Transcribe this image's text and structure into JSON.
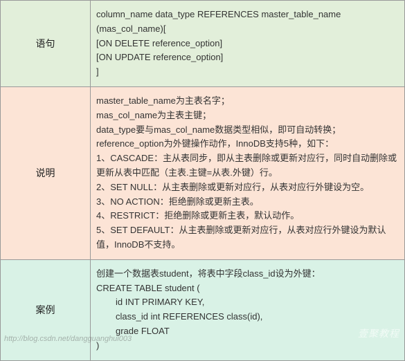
{
  "rows": [
    {
      "label": "语句",
      "contentLines": [
        "column_name  data_type REFERENCES master_table_name",
        "(mas_col_name)[",
        "[ON DELETE reference_option]",
        "[ON UPDATE reference_option]",
        "]"
      ]
    },
    {
      "label": "说明",
      "contentLines": [
        "master_table_name为主表名字；",
        "mas_col_name为主表主键；",
        "data_type要与mas_col_name数据类型相似，即可自动转换；",
        "reference_option为外键操作动作，InnoDB支持5种，如下：",
        "1、CASCADE：主从表同步，即从主表删除或更新对应行，同时自动删除或更新从表中匹配（主表.主键=从表.外键）行。",
        "2、SET NULL：从主表删除或更新对应行，从表对应行外键设为空。",
        "3、NO ACTION：拒绝删除或更新主表。",
        "4、RESTRICT：拒绝删除或更新主表，默认动作。",
        "5、SET DEFAULT：从主表删除或更新对应行，从表对应行外键设为默认值，InnoDB不支持。"
      ]
    },
    {
      "label": "案例",
      "contentLines": [
        "创建一个数据表student，将表中字段class_id设为外键：",
        "CREATE TABLE student (",
        "        id INT PRIMARY KEY,",
        "        class_id int REFERENCES class(id),",
        "        grade FLOAT",
        ")"
      ]
    }
  ],
  "watermark": "http://blog.csdn.net/dangguanghui003",
  "watermark2": "壹聚教程"
}
